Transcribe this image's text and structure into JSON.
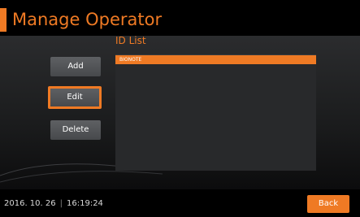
{
  "header": {
    "title": "Manage Operator"
  },
  "id_list": {
    "label": "ID List",
    "items": [
      {
        "label": "BIONOTE",
        "selected": true
      }
    ]
  },
  "actions": {
    "add_label": "Add",
    "edit_label": "Edit",
    "delete_label": "Delete"
  },
  "status_bar": {
    "date": "2016. 10. 26",
    "separator": "|",
    "time": "16:19:24",
    "back_label": "Back"
  },
  "colors": {
    "accent": "#ef7a24",
    "panel": "#2b2c2e",
    "button": "#5e6063"
  }
}
